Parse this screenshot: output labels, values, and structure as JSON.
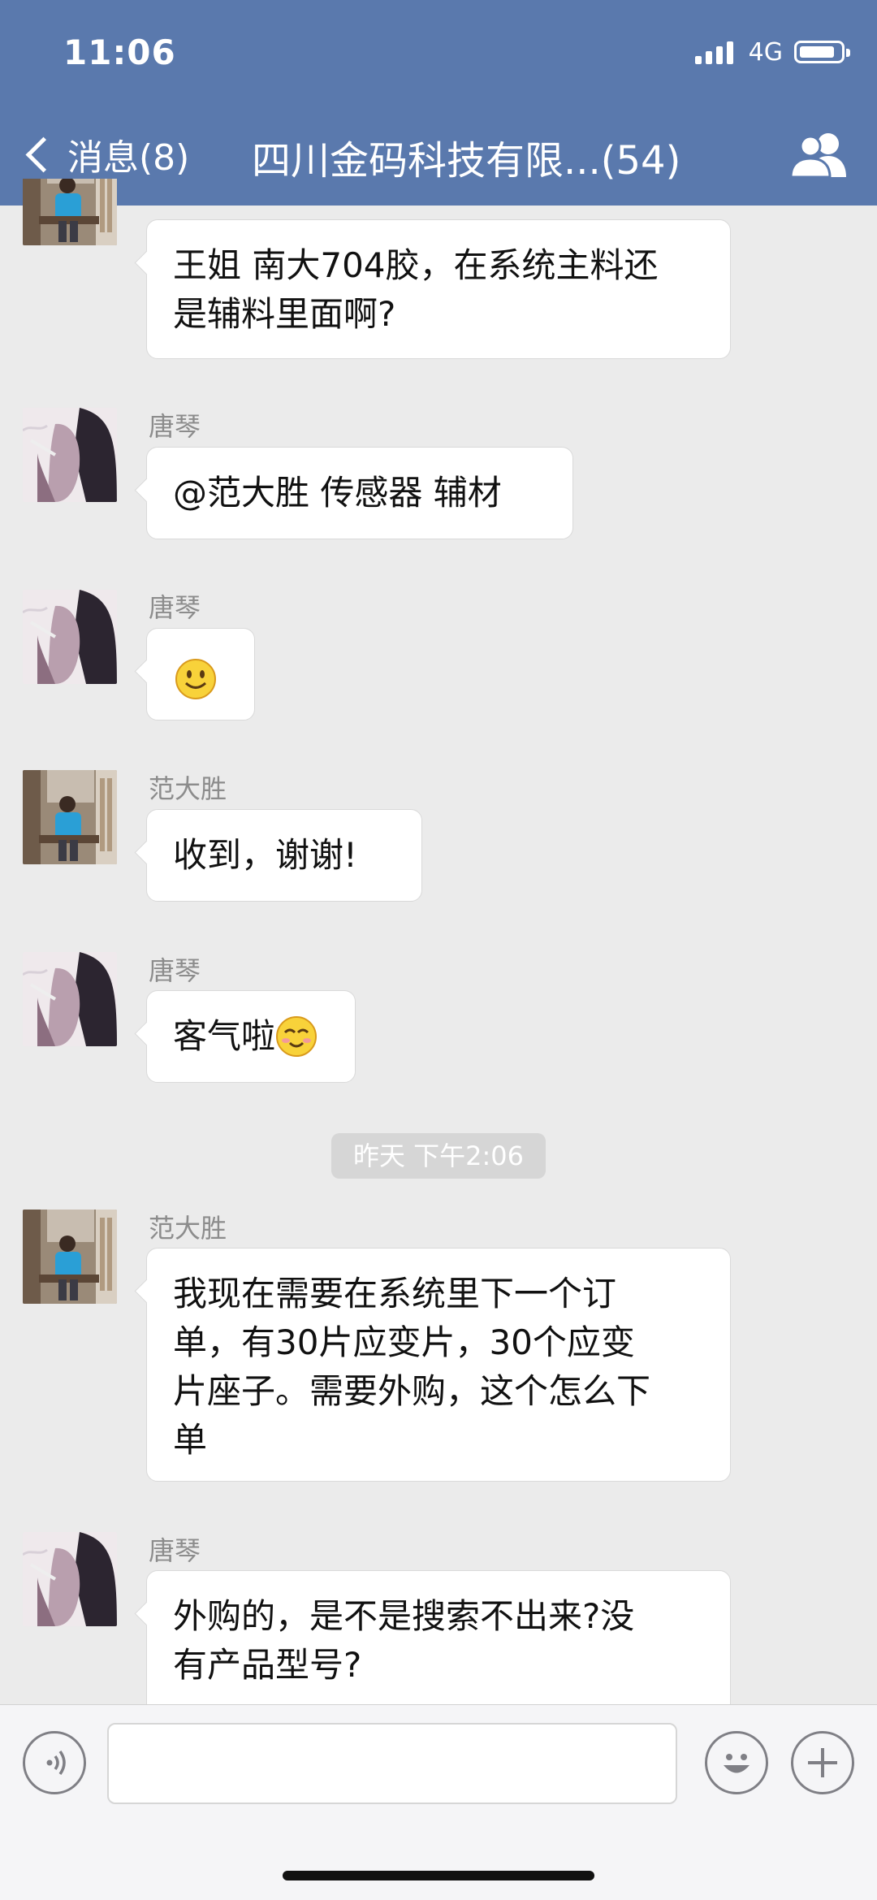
{
  "status_bar": {
    "time": "11:06",
    "network": "4G"
  },
  "nav": {
    "back_label": "消息(8)",
    "title": "四川金码科技有限...(54)"
  },
  "messages": [
    {
      "sender": "",
      "avatar": "man-avatar",
      "lines": [
        "王姐 南大704胶，在系统主料还",
        "是辅料里面啊?"
      ]
    },
    {
      "sender": "唐琴",
      "avatar": "woman-avatar",
      "lines": [
        "@范大胜  传感器 辅材"
      ]
    },
    {
      "sender": "唐琴",
      "avatar": "woman-avatar",
      "lines": [],
      "emoji": "smile-emoji"
    },
    {
      "sender": "范大胜",
      "avatar": "man-avatar",
      "lines": [
        "收到，谢谢!"
      ]
    },
    {
      "sender": "唐琴",
      "avatar": "woman-avatar",
      "lines": [
        "客气啦"
      ],
      "emoji": "blush-emoji"
    },
    {
      "sender": "范大胜",
      "avatar": "man-avatar",
      "lines": [
        "我现在需要在系统里下一个订",
        "单，有30片应变片，30个应变",
        "片座子。需要外购，这个怎么下",
        "单"
      ]
    },
    {
      "sender": "唐琴",
      "avatar": "woman-avatar",
      "lines": [
        "外购的，是不是搜索不出来?没",
        "有产品型号?"
      ]
    }
  ],
  "time_divider": "昨天 下午2:06",
  "input_bar": {
    "voice_icon": "voice-icon",
    "emoji_icon": "emoji-icon",
    "plus_icon": "plus-icon",
    "text_value": ""
  },
  "colors": {
    "nav_bg": "#5a79ad",
    "chat_bg": "#ebebeb",
    "bubble": "#ffffff"
  }
}
